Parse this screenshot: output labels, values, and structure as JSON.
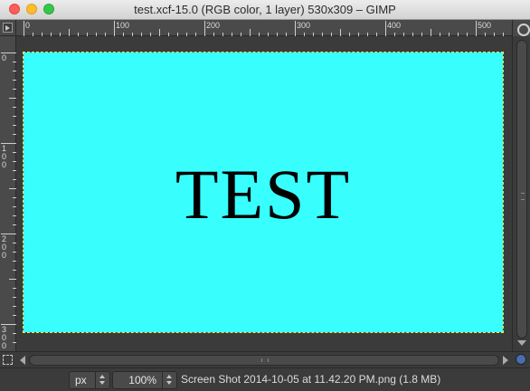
{
  "window": {
    "title": "test.xcf-15.0 (RGB color, 1 layer) 530x309 – GIMP"
  },
  "rulers": {
    "horizontal_labels": [
      "0",
      "100",
      "200",
      "300",
      "400",
      "500"
    ],
    "vertical_labels": [
      "0",
      "100",
      "200",
      "300"
    ]
  },
  "canvas": {
    "image_text": "TEST",
    "image_background": "#38fefe",
    "text_color": "#000000"
  },
  "statusbar": {
    "unit": "px",
    "zoom": "100%",
    "message": "Screen Shot 2014-10-05 at 11.42.20 PM.png (1.8 MB)"
  },
  "icons": {
    "close": "close-button-icon",
    "minimize": "minimize-button-icon",
    "zoom": "zoom-button-icon",
    "navigate": "navigate-icon",
    "quick_mask": "quick-mask-icon",
    "zoom_follow": "zoom-follow-icon"
  }
}
